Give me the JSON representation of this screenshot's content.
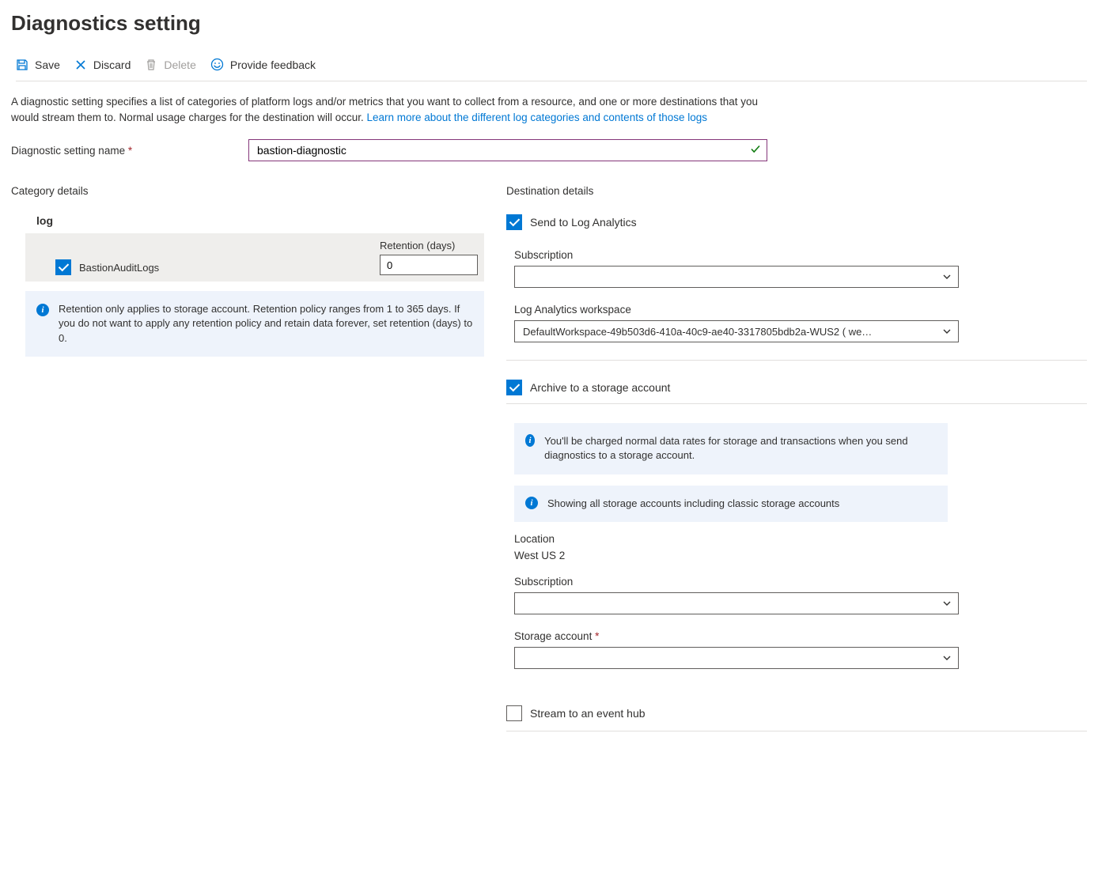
{
  "page_title": "Diagnostics setting",
  "toolbar": {
    "save": "Save",
    "discard": "Discard",
    "delete": "Delete",
    "feedback": "Provide feedback"
  },
  "description": {
    "text": "A diagnostic setting specifies a list of categories of platform logs and/or metrics that you want to collect from a resource, and one or more destinations that you would stream them to. Normal usage charges for the destination will occur. ",
    "link": "Learn more about the different log categories and contents of those logs"
  },
  "name_field": {
    "label": "Diagnostic setting name",
    "value": "bastion-diagnostic"
  },
  "category": {
    "title": "Category details",
    "log_header": "log",
    "log_name": "BastionAuditLogs",
    "log_checked": true,
    "retention_label": "Retention (days)",
    "retention_value": "0",
    "info": "Retention only applies to storage account. Retention policy ranges from 1 to 365 days. If you do not want to apply any retention policy and retain data forever, set retention (days) to 0."
  },
  "destination": {
    "title": "Destination details",
    "log_analytics": {
      "label": "Send to Log Analytics",
      "checked": true,
      "subscription_label": "Subscription",
      "subscription_value": "",
      "workspace_label": "Log Analytics workspace",
      "workspace_value": "DefaultWorkspace-49b503d6-410a-40c9-ae40-3317805bdb2a-WUS2 ( we…"
    },
    "storage": {
      "label": "Archive to a storage account",
      "checked": true,
      "info1": "You'll be charged normal data rates for storage and transactions when you send diagnostics to a storage account.",
      "info2": "Showing all storage accounts including classic storage accounts",
      "location_label": "Location",
      "location_value": "West US 2",
      "subscription_label": "Subscription",
      "subscription_value": "",
      "account_label": "Storage account",
      "account_value": ""
    },
    "eventhub": {
      "label": "Stream to an event hub",
      "checked": false
    }
  }
}
